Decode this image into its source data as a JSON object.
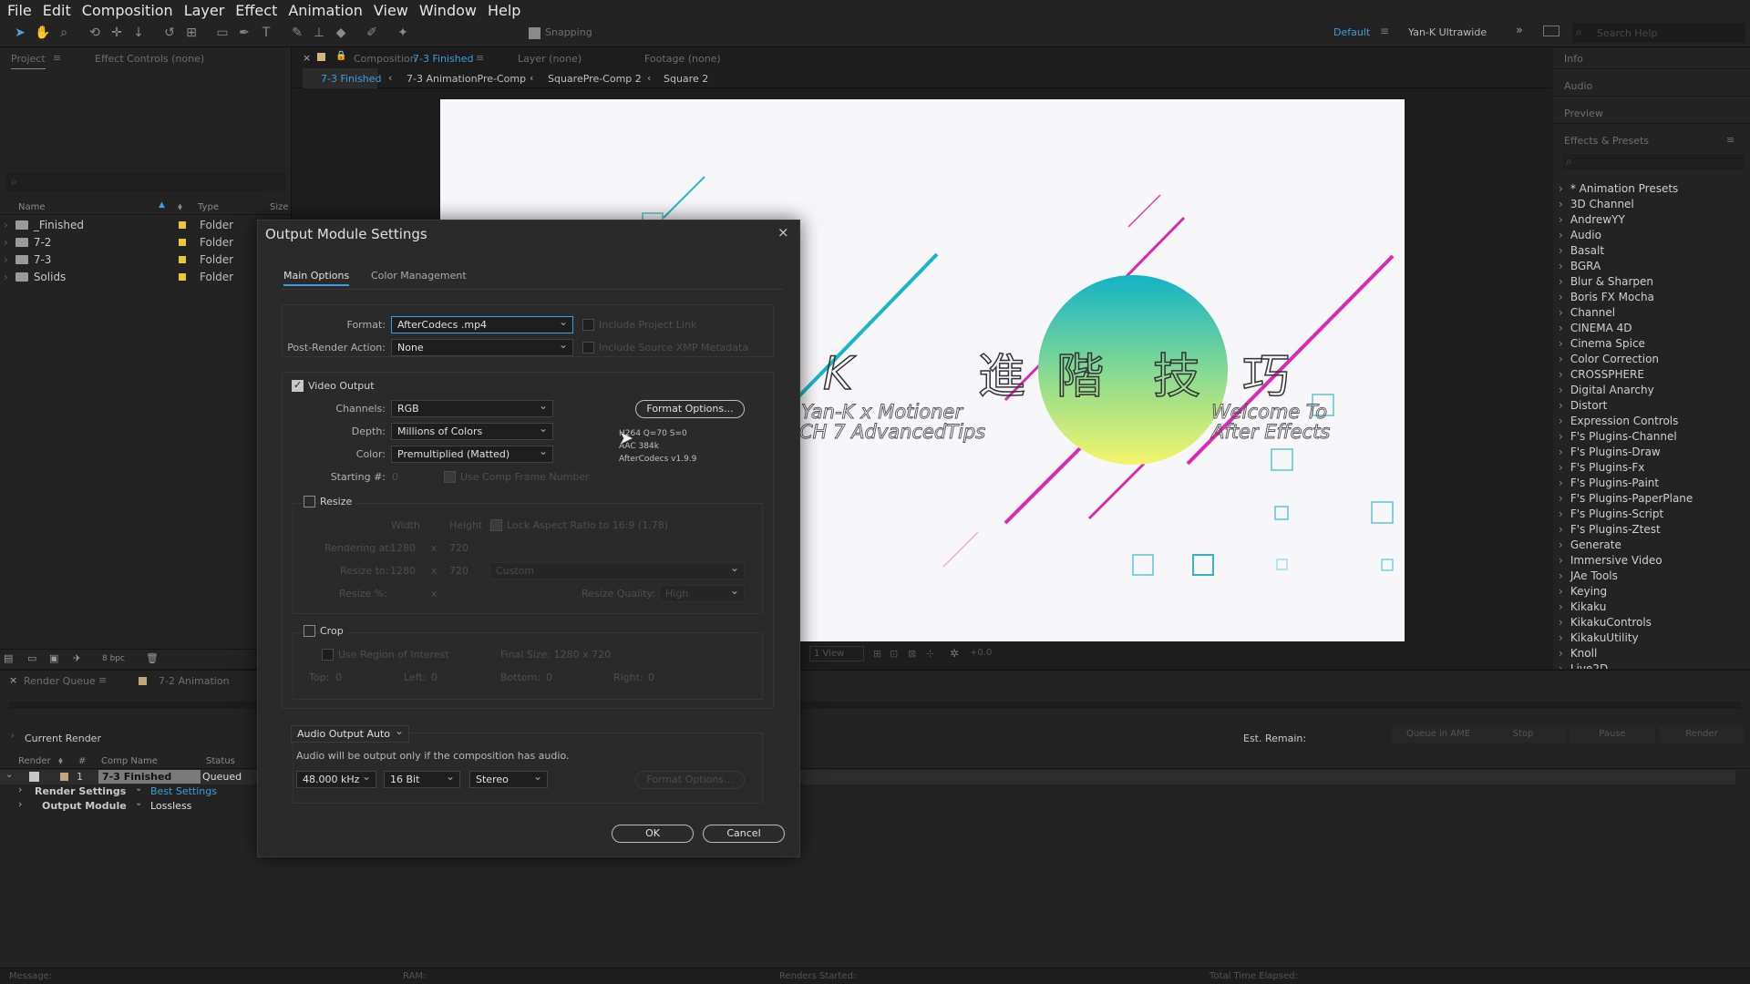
{
  "menu": [
    "File",
    "Edit",
    "Composition",
    "Layer",
    "Effect",
    "Animation",
    "View",
    "Window",
    "Help"
  ],
  "toolbar": {
    "snapping": "Snapping",
    "workspace": "Default",
    "workspace2": "Yan-K Ultrawide",
    "search_placeholder": "Search Help"
  },
  "project": {
    "tab": "Project",
    "tab2": "Effect Controls (none)",
    "cols": [
      "Name",
      "Type",
      "Size"
    ],
    "items": [
      {
        "name": "_Finished",
        "type": "Folder"
      },
      {
        "name": "7-2",
        "type": "Folder"
      },
      {
        "name": "7-3",
        "type": "Folder"
      },
      {
        "name": "Solids",
        "type": "Folder"
      }
    ],
    "bpc": "8 bpc"
  },
  "comp": {
    "tab_prefix": "Composition",
    "tab_name": "7-3 Finished",
    "layer_tab": "Layer (none)",
    "footage_tab": "Footage (none)",
    "breadcrumbs": [
      "7-3 Finished",
      "7-3 AnimationPre-Comp",
      "SquarePre-Comp 2",
      "Square 2"
    ],
    "art": {
      "k": "K",
      "chars": [
        "進",
        "階",
        "技",
        "巧"
      ],
      "line1": "Yan-K x Motioner",
      "line2": "CH 7 AdvancedTips",
      "welcome1": "Welcome To",
      "welcome2": "After Effects"
    },
    "view": "1 View",
    "exposure": "+0.0"
  },
  "right": {
    "info": "Info",
    "audio": "Audio",
    "preview": "Preview",
    "effects": "Effects & Presets",
    "effects_list": [
      "* Animation Presets",
      "3D Channel",
      "AndrewYY",
      "Audio",
      "Basalt",
      "BGRA",
      "Blur & Sharpen",
      "Boris FX Mocha",
      "Channel",
      "CINEMA 4D",
      "Cinema Spice",
      "Color Correction",
      "CROSSPHERE",
      "Digital Anarchy",
      "Distort",
      "Expression Controls",
      "F's Plugins-Channel",
      "F's Plugins-Draw",
      "F's Plugins-Fx",
      "F's Plugins-Paint",
      "F's Plugins-PaperPlane",
      "F's Plugins-Script",
      "F's Plugins-Ztest",
      "Generate",
      "Immersive Video",
      "JAe Tools",
      "Keying",
      "Kikaku",
      "KikakuControls",
      "KikakuUtility",
      "Knoll",
      "Live2D"
    ]
  },
  "renderqueue": {
    "tab": "Render Queue",
    "tab2": "7-2 Animation",
    "current": "Current Render",
    "est": "Est. Remain:",
    "buttons": [
      "Queue in AME",
      "Stop",
      "Pause",
      "Render"
    ],
    "cols": [
      "Render",
      "#",
      "Comp Name",
      "Status"
    ],
    "item": {
      "num": "1",
      "name": "7-3 Finished",
      "status": "Queued"
    },
    "render_settings_label": "Render Settings",
    "render_settings_value": "Best Settings",
    "output_module_label": "Output Module",
    "output_module_value": "Lossless",
    "status": {
      "message": "Message:",
      "ram": "RAM:",
      "renders": "Renders Started:",
      "elapsed": "Total Time Elapsed:"
    }
  },
  "dialog": {
    "title": "Output Module Settings",
    "tabs": [
      "Main Options",
      "Color Management"
    ],
    "format_label": "Format:",
    "format_value": "AfterCodecs .mp4",
    "include_link": "Include Project Link",
    "post_label": "Post-Render Action:",
    "post_value": "None",
    "include_xmp": "Include Source XMP Metadata",
    "video_output": "Video Output",
    "channels_label": "Channels:",
    "channels_value": "RGB",
    "depth_label": "Depth:",
    "depth_value": "Millions of Colors",
    "color_label": "Color:",
    "color_value": "Premultiplied (Matted)",
    "starting_label": "Starting #:",
    "starting_value": "0",
    "use_comp_frame": "Use Comp Frame Number",
    "format_options": "Format Options...",
    "codec_info": [
      "H264 Q=70 S=0",
      "AAC 384k",
      "AfterCodecs v1.9.9"
    ],
    "resize": "Resize",
    "width": "Width",
    "height": "Height",
    "lock_aspect": "Lock Aspect Ratio to 16:9 (1.78)",
    "rendering_at": "Rendering at:",
    "r_w": "1280",
    "r_h": "720",
    "resize_to": "Resize to:",
    "rt_w": "1280",
    "rt_h": "720",
    "custom": "Custom",
    "resize_pct": "Resize %:",
    "x": "x",
    "resize_quality": "Resize Quality:",
    "quality": "High",
    "crop": "Crop",
    "use_roi": "Use Region of Interest",
    "final_size": "Final Size: 1280 x 720",
    "top": "Top:",
    "left": "Left:",
    "bottom": "Bottom:",
    "right": "Right:",
    "zero": "0",
    "audio_auto": "Audio Output Auto",
    "audio_note": "Audio will be output only if the composition has audio.",
    "khz": "48.000 kHz",
    "bit": "16 Bit",
    "stereo": "Stereo",
    "audio_fmt": "Format Options...",
    "ok": "OK",
    "cancel": "Cancel"
  }
}
